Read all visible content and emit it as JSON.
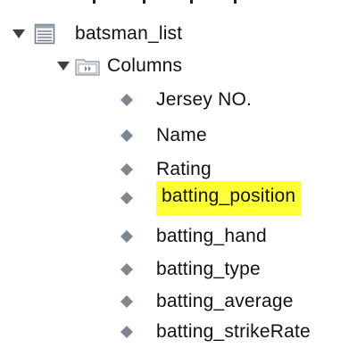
{
  "tree": {
    "table": {
      "label": "batsman_list",
      "expanded": true,
      "icon": "table-icon"
    },
    "columns_folder": {
      "label": "Columns",
      "expanded": true,
      "icon": "folder-icon"
    },
    "columns": [
      {
        "label": "Jersey NO.",
        "highlighted": false
      },
      {
        "label": "Name",
        "highlighted": false
      },
      {
        "label": "Rating",
        "highlighted": false
      },
      {
        "label": "batting_position",
        "highlighted": true
      },
      {
        "label": "batting_hand",
        "highlighted": false
      },
      {
        "label": "batting_type",
        "highlighted": false
      },
      {
        "label": "batting_average",
        "highlighted": false
      },
      {
        "label": "batting_strikeRate",
        "highlighted": false
      }
    ],
    "column_icon": "diamond-icon",
    "highlight_color": "#ffff33"
  }
}
